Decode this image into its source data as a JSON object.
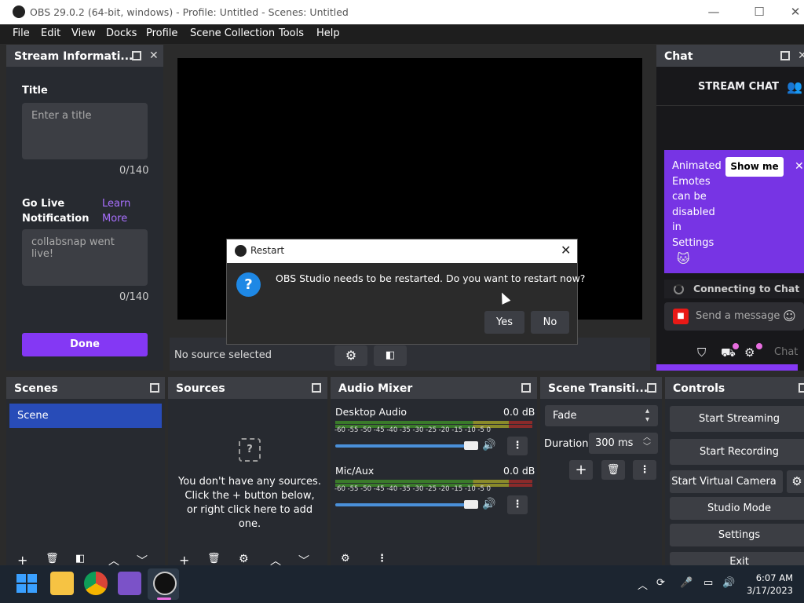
{
  "window": {
    "title": "OBS 29.0.2 (64-bit, windows) - Profile: Untitled - Scenes: Untitled",
    "minimize": "—",
    "maximize": "☐",
    "close": "✕"
  },
  "menu": [
    "File",
    "Edit",
    "View",
    "Docks",
    "Profile",
    "Scene Collection",
    "Tools",
    "Help"
  ],
  "stream_info": {
    "header": "Stream Informati...",
    "title_label": "Title",
    "title_placeholder": "Enter a title",
    "title_count": "0/140",
    "golive_label": "Go Live Notification",
    "learn_more": "Learn More",
    "golive_value": "collabsnap went live!",
    "golive_count": "0/140",
    "done": "Done"
  },
  "preview": {
    "no_source": "No source selected"
  },
  "chat": {
    "header": "Chat",
    "stream_chat": "STREAM CHAT",
    "promo_text": "Animated Emotes can be disabled in Settings",
    "show_me": "Show me",
    "connecting": "Connecting to Chat",
    "send_placeholder": "Send a message",
    "chat_btn": "Chat"
  },
  "dialog": {
    "title": "Restart",
    "message": "OBS Studio needs to be restarted. Do you want to restart now?",
    "yes": "Yes",
    "no": "No"
  },
  "scenes": {
    "header": "Scenes",
    "items": [
      "Scene"
    ]
  },
  "sources": {
    "header": "Sources",
    "empty_line1": "You don't have any sources.",
    "empty_line2": "Click the + button below,",
    "empty_line3": "or right click here to add one."
  },
  "audio": {
    "header": "Audio Mixer",
    "ticks": "-60 -55 -50 -45 -40 -35 -30 -25 -20 -15 -10 -5 0",
    "channels": [
      {
        "name": "Desktop Audio",
        "db": "0.0 dB",
        "volume": 1.0
      },
      {
        "name": "Mic/Aux",
        "db": "0.0 dB",
        "volume": 1.0
      }
    ]
  },
  "transitions": {
    "header": "Scene Transiti...",
    "selected": "Fade",
    "duration_label": "Duration",
    "duration_value": "300 ms"
  },
  "controls": {
    "header": "Controls",
    "buttons": [
      "Start Streaming",
      "Start Recording",
      "Start Virtual Camera",
      "Studio Mode",
      "Settings",
      "Exit"
    ]
  },
  "taskbar": {
    "time": "6:07 AM",
    "date": "3/17/2023"
  }
}
